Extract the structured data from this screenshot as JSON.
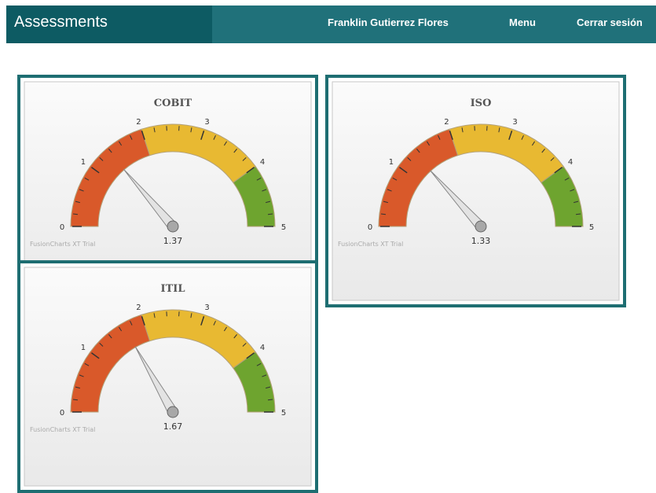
{
  "header": {
    "brand": "Assessments",
    "user_name": "Franklin Gutierrez Flores",
    "menu_label": "Menu",
    "logout_label": "Cerrar sesión",
    "bar_color": "#20717a",
    "brand_bg_color": "#0d5b63"
  },
  "gauge_scale": {
    "min": 0,
    "max": 5,
    "tick_labels": [
      "0",
      "1",
      "2",
      "3",
      "4",
      "5"
    ],
    "bands": [
      {
        "from": 0,
        "to": 2,
        "color": "#d9592a"
      },
      {
        "from": 2,
        "to": 4,
        "color": "#e8b932"
      },
      {
        "from": 4,
        "to": 5,
        "color": "#6ea42f"
      }
    ]
  },
  "gauges": [
    {
      "title": "COBIT",
      "value": 1.37,
      "value_label": "1.37",
      "watermark": "FusionCharts XT Trial"
    },
    {
      "title": "ISO",
      "value": 1.33,
      "value_label": "1.33",
      "watermark": "FusionCharts XT Trial"
    },
    {
      "title": "ITIL",
      "value": 1.67,
      "value_label": "1.67",
      "watermark": "FusionCharts XT Trial"
    }
  ]
}
